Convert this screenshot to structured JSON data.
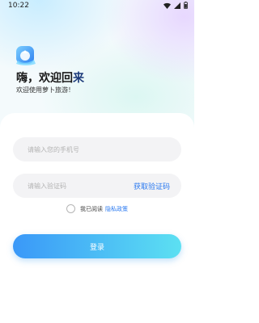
{
  "status_bar": {
    "time": "10:22"
  },
  "header": {
    "greeting_prefix": "嗨，欢迎回",
    "greeting_accent": "来",
    "subtitle": "欢迎使用萝卜旅游！"
  },
  "form": {
    "phone_placeholder": "请输入您的手机号",
    "code_placeholder": "请输入验证码",
    "get_code_label": "获取验证码",
    "agreement_text": "我已阅读",
    "privacy_label": "隐私政策",
    "login_label": "登录"
  },
  "colors": {
    "accent": "#2a79f0",
    "button_start": "#3a98f8",
    "button_end": "#5ce0f2"
  },
  "icons": [
    "logo-icon",
    "wifi-icon",
    "signal-icon",
    "battery-icon"
  ]
}
